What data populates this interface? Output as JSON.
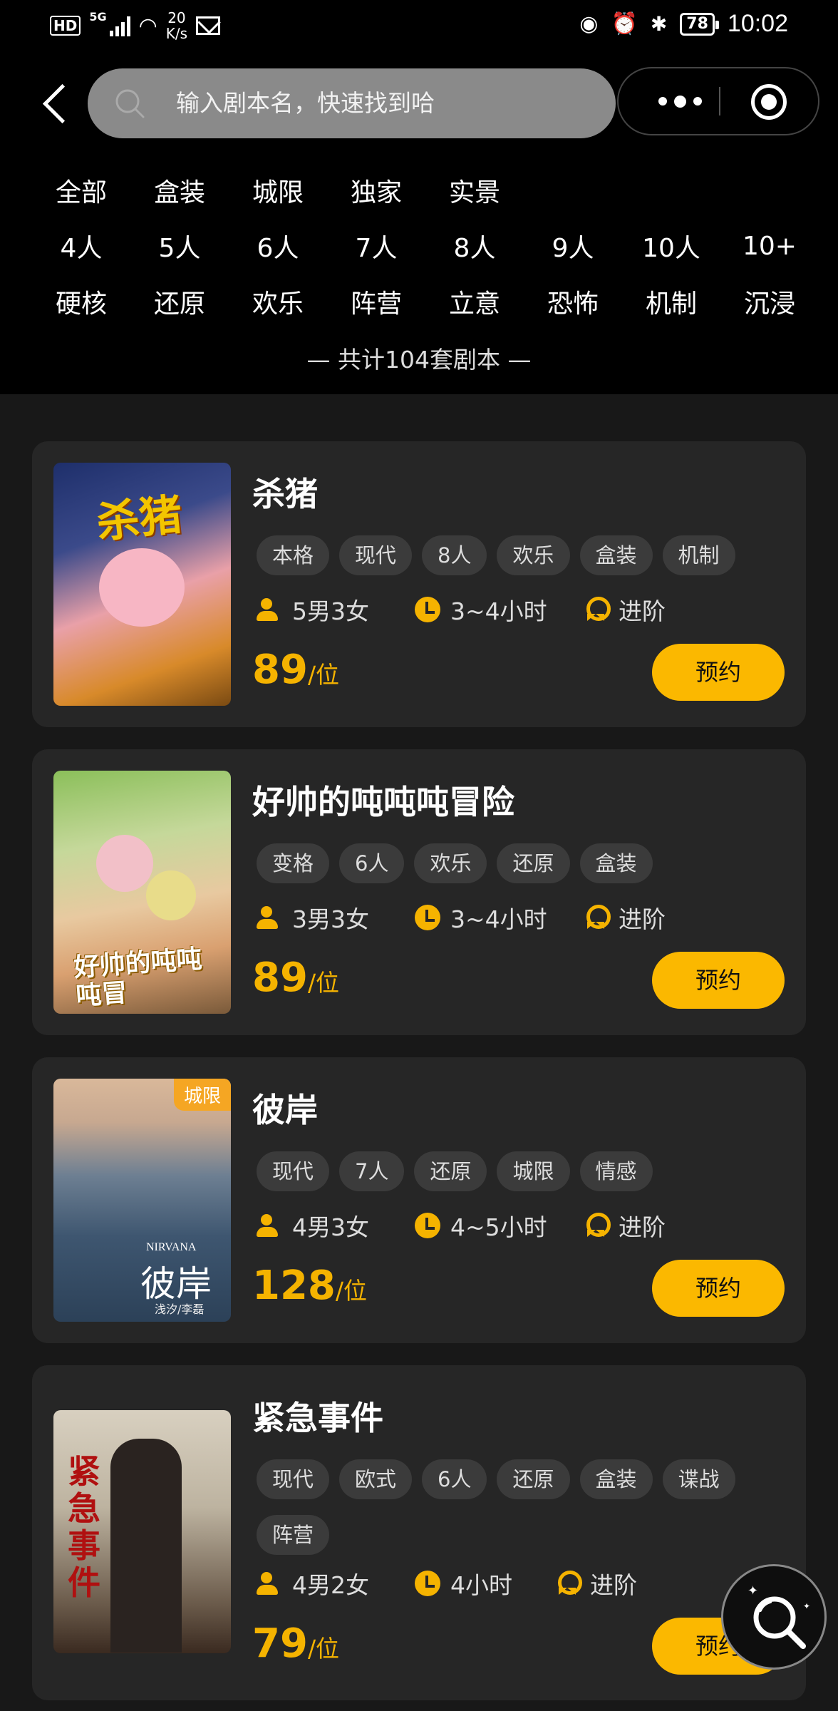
{
  "status_bar": {
    "hd": "HD",
    "network": "5G",
    "speed_value": "20",
    "speed_unit": "K/s",
    "battery": "78",
    "time": "10:02",
    "icons": [
      "eye-icon",
      "alarm-icon",
      "bluetooth-icon"
    ]
  },
  "search": {
    "placeholder": "输入剧本名，快速找到哈"
  },
  "filters": {
    "row1": [
      "全部",
      "盒装",
      "城限",
      "独家",
      "实景"
    ],
    "row2": [
      "4人",
      "5人",
      "6人",
      "7人",
      "8人",
      "9人",
      "10人",
      "10+"
    ],
    "row3": [
      "硬核",
      "还原",
      "欢乐",
      "阵营",
      "立意",
      "恐怖",
      "机制",
      "沉浸"
    ]
  },
  "total_text": "— 共计104套剧本 —",
  "scripts": [
    {
      "title": "杀猪",
      "tags": [
        "本格",
        "现代",
        "8人",
        "欢乐",
        "盒装",
        "机制"
      ],
      "players": "5男3女",
      "duration": "3~4小时",
      "level": "进阶",
      "price": "89",
      "unit": "/位",
      "button": "预约",
      "cover_text": "杀猪"
    },
    {
      "title": "好帅的吨吨吨冒险",
      "tags": [
        "变格",
        "6人",
        "欢乐",
        "还原",
        "盒装"
      ],
      "players": "3男3女",
      "duration": "3~4小时",
      "level": "进阶",
      "price": "89",
      "unit": "/位",
      "button": "预约",
      "cover_text": "好帅的吨吨吨冒"
    },
    {
      "title": "彼岸",
      "tags": [
        "现代",
        "7人",
        "还原",
        "城限",
        "情感"
      ],
      "players": "4男3女",
      "duration": "4~5小时",
      "level": "进阶",
      "price": "128",
      "unit": "/位",
      "button": "预约",
      "corner_tag": "城限",
      "cover_text": "彼岸",
      "cover_sub": "NIRVANA",
      "cover_author": "浅汐/李磊"
    },
    {
      "title": "紧急事件",
      "tags": [
        "现代",
        "欧式",
        "6人",
        "还原",
        "盒装",
        "谍战",
        "阵营"
      ],
      "players": "4男2女",
      "duration": "4小时",
      "level": "进阶",
      "price": "79",
      "unit": "/位",
      "button": "预约",
      "cover_text": "紧急事件"
    }
  ],
  "colors": {
    "accent": "#fbb800",
    "card_bg": "#262626",
    "page_bg": "#181818",
    "header_bg": "#000000"
  }
}
